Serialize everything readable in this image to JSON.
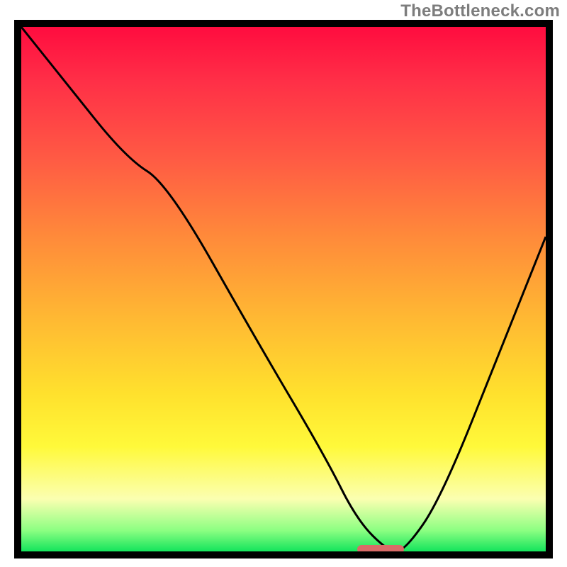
{
  "watermark": "TheBottleneck.com",
  "chart_data": {
    "type": "line",
    "title": "",
    "xlabel": "",
    "ylabel": "",
    "xlim": [
      0,
      100
    ],
    "ylim": [
      0,
      100
    ],
    "series": [
      {
        "name": "curve",
        "color": "#000000",
        "x": [
          0,
          8,
          20,
          28,
          45,
          58,
          64,
          70,
          73,
          80,
          92,
          100
        ],
        "y": [
          100,
          90,
          75,
          70,
          40,
          18,
          6,
          0,
          0,
          10,
          40,
          60
        ]
      }
    ],
    "annotations": [
      {
        "name": "marker",
        "color": "#d96b68",
        "x0": 64,
        "x1": 73,
        "y": 0
      }
    ],
    "background_gradient": {
      "stops": [
        {
          "pos": 0.0,
          "color": "#ff0c3f"
        },
        {
          "pos": 0.1,
          "color": "#ff2e47"
        },
        {
          "pos": 0.25,
          "color": "#ff5a44"
        },
        {
          "pos": 0.4,
          "color": "#ff8a3a"
        },
        {
          "pos": 0.55,
          "color": "#ffb733"
        },
        {
          "pos": 0.7,
          "color": "#ffe12d"
        },
        {
          "pos": 0.8,
          "color": "#fff93a"
        },
        {
          "pos": 0.9,
          "color": "#fbffb1"
        },
        {
          "pos": 0.96,
          "color": "#8cff82"
        },
        {
          "pos": 1.0,
          "color": "#14e45c"
        }
      ]
    }
  }
}
